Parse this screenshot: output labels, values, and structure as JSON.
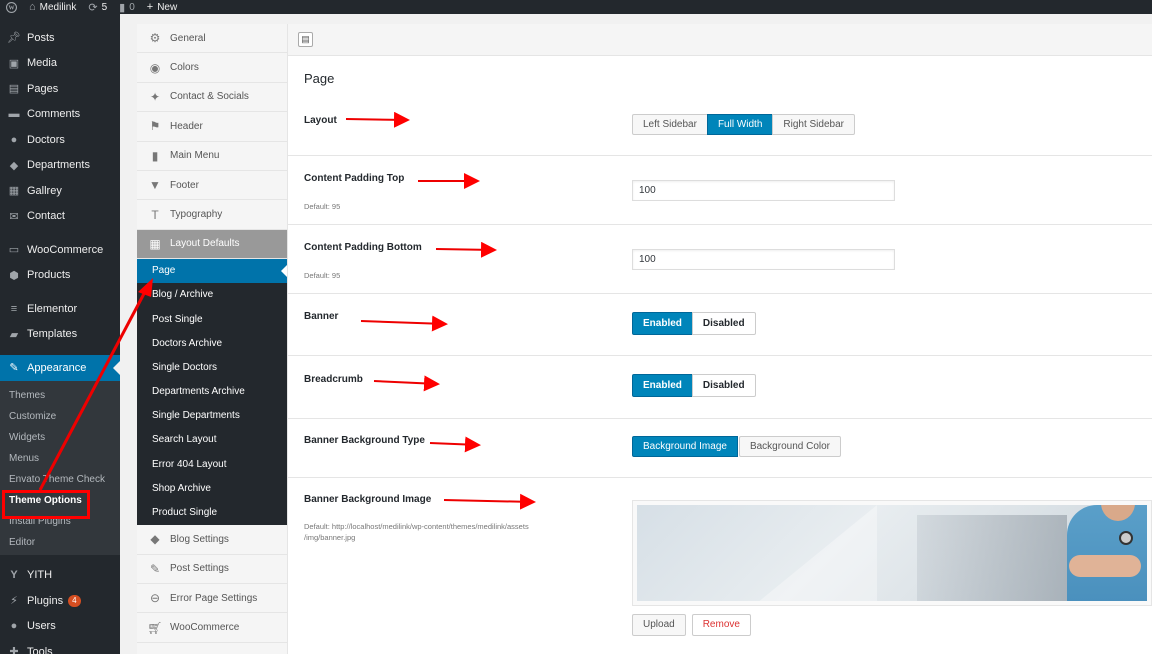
{
  "adminbar": {
    "site_name": "Medilink",
    "updates_count": "5",
    "comments_count": "0",
    "new_label": "New"
  },
  "admin_menu": {
    "items_top": [
      {
        "label": "Posts",
        "icon": "pin-icon"
      },
      {
        "label": "Media",
        "icon": "media-icon"
      },
      {
        "label": "Pages",
        "icon": "pages-icon"
      },
      {
        "label": "Comments",
        "icon": "comments-icon"
      },
      {
        "label": "Doctors",
        "icon": "doctors-icon"
      },
      {
        "label": "Departments",
        "icon": "departments-icon"
      },
      {
        "label": "Gallrey",
        "icon": "gallery-icon"
      },
      {
        "label": "Contact",
        "icon": "contact-icon"
      }
    ],
    "items_mid": [
      {
        "label": "WooCommerce",
        "icon": "woocommerce-icon"
      },
      {
        "label": "Products",
        "icon": "products-icon"
      }
    ],
    "items_mid2": [
      {
        "label": "Elementor",
        "icon": "elementor-icon"
      },
      {
        "label": "Templates",
        "icon": "templates-icon"
      }
    ],
    "current": {
      "label": "Appearance",
      "icon": "paintbrush-icon"
    },
    "appearance_sub": [
      "Themes",
      "Customize",
      "Widgets",
      "Menus",
      "Envato Theme Check",
      "Theme Options",
      "Install Plugins",
      "Editor"
    ],
    "items_bottom": [
      {
        "label": "YITH",
        "icon": "yith-icon"
      },
      {
        "label": "Plugins",
        "icon": "plugins-icon",
        "badge": "4"
      },
      {
        "label": "Users",
        "icon": "users-icon"
      },
      {
        "label": "Tools",
        "icon": "tools-icon"
      }
    ]
  },
  "options_sidebar": {
    "groups_top": [
      {
        "label": "General",
        "icon": "gear-icon"
      },
      {
        "label": "Colors",
        "icon": "eye-icon"
      },
      {
        "label": "Contact & Socials",
        "icon": "twitter-icon"
      },
      {
        "label": "Header",
        "icon": "flag-icon"
      },
      {
        "label": "Main Menu",
        "icon": "book-icon"
      },
      {
        "label": "Footer",
        "icon": "triangle-down-icon"
      },
      {
        "label": "Typography",
        "icon": "text-icon"
      }
    ],
    "active_group": {
      "label": "Layout Defaults",
      "icon": "grid-icon"
    },
    "layout_sub": [
      "Page",
      "Blog / Archive",
      "Post Single",
      "Doctors Archive",
      "Single Doctors",
      "Departments Archive",
      "Single Departments",
      "Search Layout",
      "Error 404 Layout",
      "Shop Archive",
      "Product Single"
    ],
    "groups_bottom": [
      {
        "label": "Blog Settings",
        "icon": "tag-icon"
      },
      {
        "label": "Post Settings",
        "icon": "edit-icon"
      },
      {
        "label": "Error Page Settings",
        "icon": "minus-circle-icon"
      },
      {
        "label": "WooCommerce",
        "icon": "cart-icon"
      }
    ]
  },
  "main": {
    "section_title": "Page",
    "layout": {
      "label": "Layout",
      "options": [
        "Left Sidebar",
        "Full Width",
        "Right Sidebar"
      ],
      "selected": "Full Width"
    },
    "padding_top": {
      "label": "Content Padding Top",
      "desc": "Default: 95",
      "value": "100"
    },
    "padding_bottom": {
      "label": "Content Padding Bottom",
      "desc": "Default: 95",
      "value": "100"
    },
    "banner": {
      "label": "Banner",
      "options": [
        "Enabled",
        "Disabled"
      ],
      "selected": "Enabled"
    },
    "breadcrumb": {
      "label": "Breadcrumb",
      "options": [
        "Enabled",
        "Disabled"
      ],
      "selected": "Enabled"
    },
    "banner_bg_type": {
      "label": "Banner Background Type",
      "options": [
        "Background Image",
        "Background Color"
      ],
      "selected": "Background Image"
    },
    "banner_bg_image": {
      "label": "Banner Background Image",
      "desc": "Default: http://localhost/medilink/wp-content/themes/medilink/assets /img/banner.jpg",
      "upload_label": "Upload",
      "remove_label": "Remove"
    }
  },
  "colors": {
    "wp_dark": "#23282d",
    "wp_blue": "#0073aa",
    "annotation_red": "#ff0000"
  }
}
